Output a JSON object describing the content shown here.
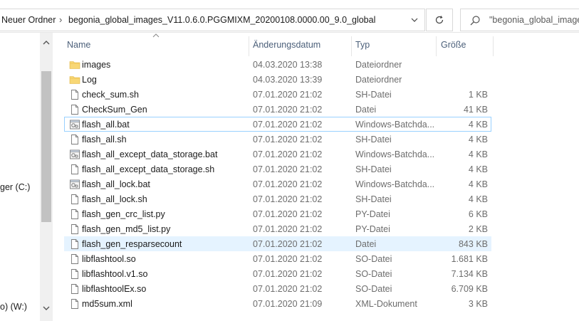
{
  "address": {
    "crumbs": [
      "Neuer Ordner",
      "begonia_global_images_V11.0.6.0.PGGMIXM_20200108.0000.00_9.0_global"
    ]
  },
  "search": {
    "text": "\"begonia_global_images"
  },
  "nav": {
    "items": [
      {
        "label": "ger (C:)"
      },
      {
        "label": "o) (W:)"
      }
    ]
  },
  "columns": {
    "name": "Name",
    "date": "Änderungsdatum",
    "type": "Typ",
    "size": "Größe"
  },
  "files": [
    {
      "name": "images",
      "date": "04.03.2020 13:38",
      "type": "Dateiordner",
      "size": "",
      "icon": "folder-icon"
    },
    {
      "name": "Log",
      "date": "04.03.2020 13:39",
      "type": "Dateiordner",
      "size": "",
      "icon": "folder-icon"
    },
    {
      "name": "check_sum.sh",
      "date": "07.01.2020 21:02",
      "type": "SH-Datei",
      "size": "1 KB",
      "icon": "file-icon"
    },
    {
      "name": "CheckSum_Gen",
      "date": "07.01.2020 21:02",
      "type": "Datei",
      "size": "41 KB",
      "icon": "file-icon"
    },
    {
      "name": "flash_all.bat",
      "date": "07.01.2020 21:02",
      "type": "Windows-Batchda...",
      "size": "4 KB",
      "icon": "batch-file-icon"
    },
    {
      "name": "flash_all.sh",
      "date": "07.01.2020 21:02",
      "type": "SH-Datei",
      "size": "4 KB",
      "icon": "file-icon"
    },
    {
      "name": "flash_all_except_data_storage.bat",
      "date": "07.01.2020 21:02",
      "type": "Windows-Batchda...",
      "size": "4 KB",
      "icon": "batch-file-icon"
    },
    {
      "name": "flash_all_except_data_storage.sh",
      "date": "07.01.2020 21:02",
      "type": "SH-Datei",
      "size": "4 KB",
      "icon": "file-icon"
    },
    {
      "name": "flash_all_lock.bat",
      "date": "07.01.2020 21:02",
      "type": "Windows-Batchda...",
      "size": "4 KB",
      "icon": "batch-file-icon"
    },
    {
      "name": "flash_all_lock.sh",
      "date": "07.01.2020 21:02",
      "type": "SH-Datei",
      "size": "4 KB",
      "icon": "file-icon"
    },
    {
      "name": "flash_gen_crc_list.py",
      "date": "07.01.2020 21:02",
      "type": "PY-Datei",
      "size": "6 KB",
      "icon": "file-icon"
    },
    {
      "name": "flash_gen_md5_list.py",
      "date": "07.01.2020 21:02",
      "type": "PY-Datei",
      "size": "2 KB",
      "icon": "file-icon"
    },
    {
      "name": "flash_gen_resparsecount",
      "date": "07.01.2020 21:02",
      "type": "Datei",
      "size": "843 KB",
      "icon": "file-icon"
    },
    {
      "name": "libflashtool.so",
      "date": "07.01.2020 21:02",
      "type": "SO-Datei",
      "size": "1.681 KB",
      "icon": "file-icon"
    },
    {
      "name": "libflashtool.v1.so",
      "date": "07.01.2020 21:02",
      "type": "SO-Datei",
      "size": "7.134 KB",
      "icon": "file-icon"
    },
    {
      "name": "libflashtoolEx.so",
      "date": "07.01.2020 21:02",
      "type": "SO-Datei",
      "size": "6.709 KB",
      "icon": "file-icon"
    },
    {
      "name": "md5sum.xml",
      "date": "07.01.2020 21:09",
      "type": "XML-Dokument",
      "size": "3 KB",
      "icon": "file-icon"
    }
  ],
  "state": {
    "selected_index": 4,
    "hover_index": 12
  },
  "colors": {
    "folder": "#f8d775",
    "selection_border": "#99d1ff",
    "hover_bg": "#e5f3ff",
    "header_text": "#4c607a"
  }
}
